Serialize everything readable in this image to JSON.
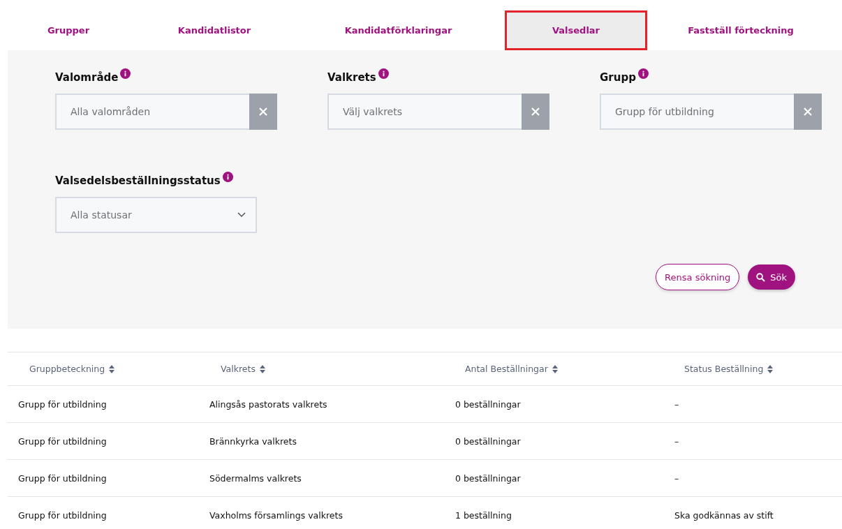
{
  "tabs": [
    {
      "label": "Grupper",
      "selected": false,
      "highlighted": false
    },
    {
      "label": "Kandidatlistor",
      "selected": false,
      "highlighted": false
    },
    {
      "label": "Kandidatförklaringar",
      "selected": false,
      "highlighted": false
    },
    {
      "label": "Valsedlar",
      "selected": true,
      "highlighted": true
    },
    {
      "label": "Fastställ förteckning",
      "selected": false,
      "highlighted": false
    }
  ],
  "filters": [
    {
      "kind": "clearable",
      "label": "Valområde",
      "placeholder": "Alla valområden"
    },
    {
      "kind": "clearable",
      "label": "Valkrets",
      "placeholder": "Välj valkrets"
    },
    {
      "kind": "clearable",
      "label": "Grupp",
      "placeholder": "Grupp för utbildning"
    },
    {
      "kind": "dropdown",
      "label": "Valsedelsbeställningsstatus",
      "placeholder": "Alla statusar"
    }
  ],
  "buttons": {
    "clear": "Rensa sökning",
    "search": "Sök"
  },
  "table": {
    "columns": [
      "Gruppbeteckning",
      "Valkrets",
      "Antal Beställningar",
      "Status Beställning"
    ],
    "rows": [
      [
        "Grupp för utbildning",
        "Alingsås pastorats valkrets",
        "0 beställningar",
        "–"
      ],
      [
        "Grupp för utbildning",
        "Brännkyrka valkrets",
        "0 beställningar",
        "–"
      ],
      [
        "Grupp för utbildning",
        "Södermalms valkrets",
        "0 beställningar",
        "–"
      ],
      [
        "Grupp för utbildning",
        "Vaxholms församlings valkrets",
        "1 beställning",
        "Ska godkännas av stift"
      ]
    ]
  }
}
